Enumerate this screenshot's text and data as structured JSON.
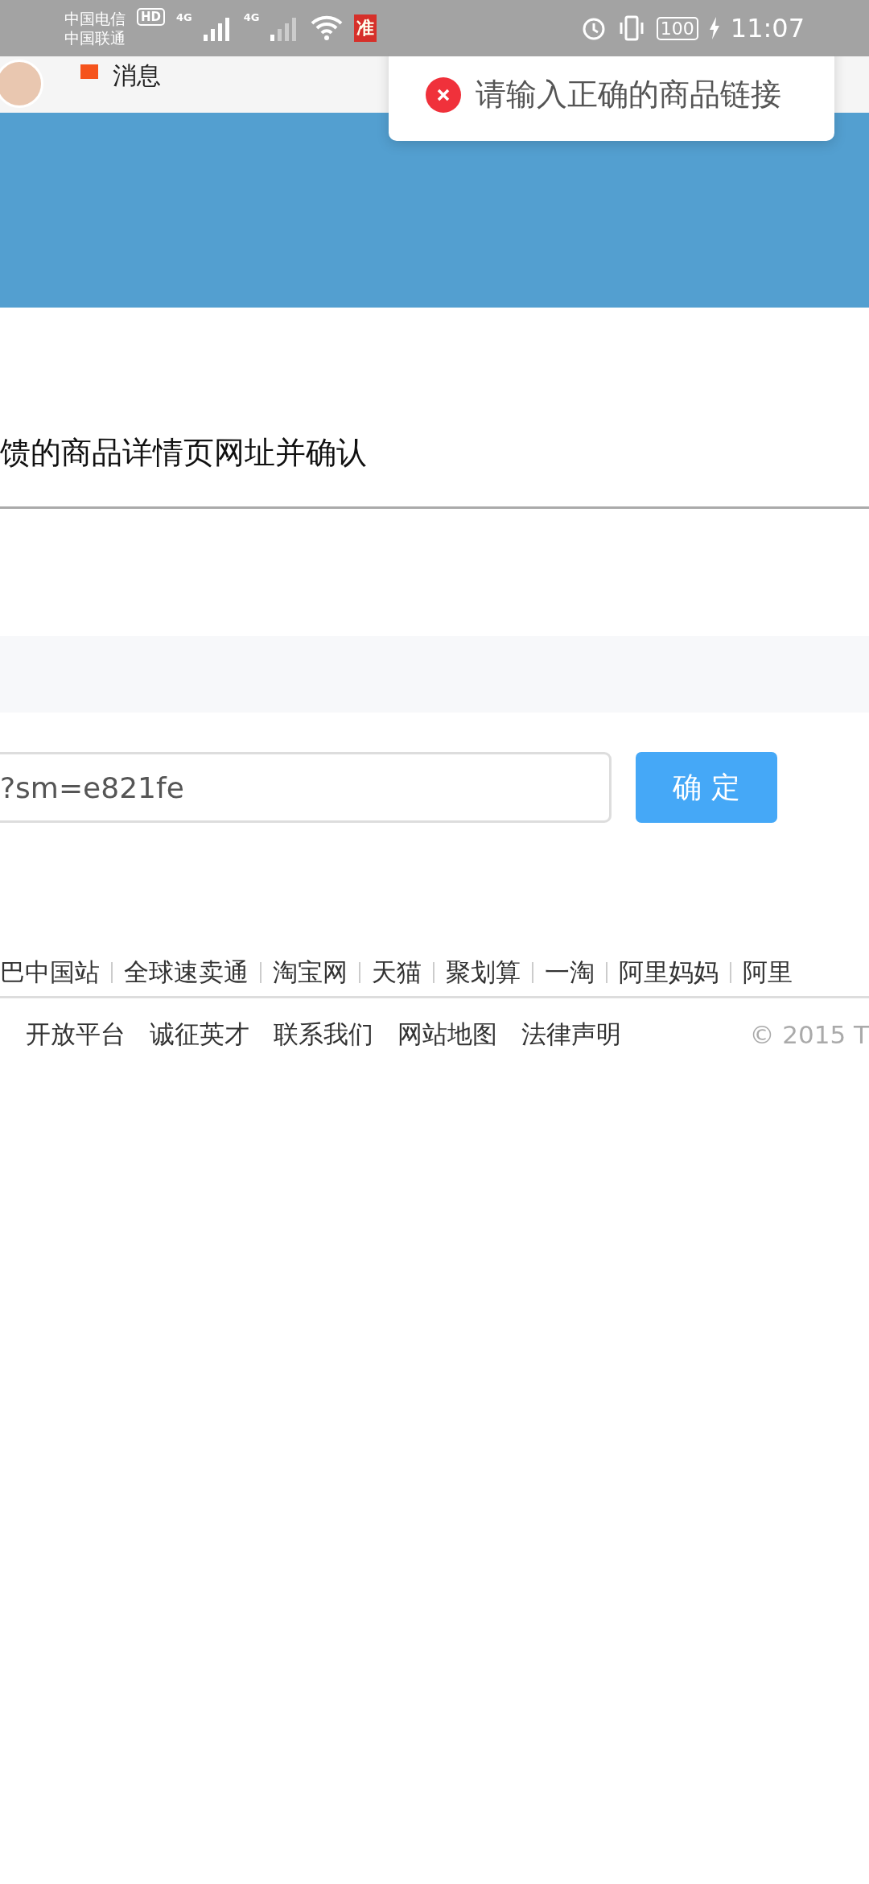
{
  "status_bar": {
    "carriers": [
      "中国电信",
      "中国联通"
    ],
    "hd": "HD",
    "networks": [
      "4G",
      "4G"
    ],
    "app_badge": "准",
    "battery": "100",
    "time": "11:07"
  },
  "top_nav": {
    "messages": "消息"
  },
  "toast": {
    "message": "请输入正确的商品链接"
  },
  "instruction": "馈的商品详情页网址并确认",
  "link_field": {
    "value": "?sm=e821fe"
  },
  "confirm_button": "确 定",
  "footer": {
    "links": [
      "巴中国站",
      "全球速卖通",
      "淘宝网",
      "天猫",
      "聚划算",
      "一淘",
      "阿里妈妈",
      "阿里"
    ],
    "links_2": [
      "开放平台",
      "诚征英才",
      "联系我们",
      "网站地图",
      "法律声明"
    ],
    "copyright": "© 2015 T"
  }
}
